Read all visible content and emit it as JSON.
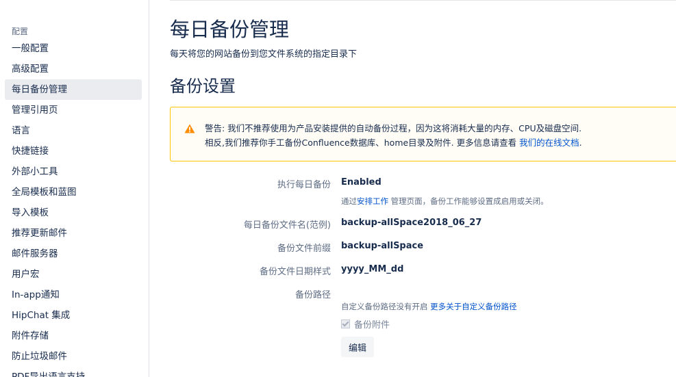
{
  "sidebar": {
    "heading": "配置",
    "items": [
      {
        "label": "一般配置"
      },
      {
        "label": "高级配置"
      },
      {
        "label": "每日备份管理",
        "active": true
      },
      {
        "label": "管理引用页"
      },
      {
        "label": "语言"
      },
      {
        "label": "快捷链接"
      },
      {
        "label": "外部小工具"
      },
      {
        "label": "全局模板和蓝图"
      },
      {
        "label": "导入模板"
      },
      {
        "label": "推荐更新邮件"
      },
      {
        "label": "邮件服务器"
      },
      {
        "label": "用户宏"
      },
      {
        "label": "In-app通知"
      },
      {
        "label": "HipChat 集成"
      },
      {
        "label": "附件存储"
      },
      {
        "label": "防止垃圾邮件"
      },
      {
        "label": "PDF导出语言支持"
      }
    ]
  },
  "main": {
    "title": "每日备份管理",
    "description": "每天将您的网站备份到您文件系统的指定目录下",
    "section_title": "备份设置",
    "warning": {
      "icon": "warning-icon",
      "line1": "警告: 我们不推荐使用为产品安装提供的自动备份过程，因为这将消耗大量的内存、CPU及磁盘空间.",
      "line2_prefix": "相反,我们推荐你手工备份Confluence数据库、home目录及附件. 更多信息请查看 ",
      "line2_link": "我们的在线文档",
      "line2_suffix": "."
    },
    "form": {
      "daily_backup_label": "执行每日备份",
      "daily_backup_value": "Enabled",
      "daily_backup_hint_prefix": "通过",
      "daily_backup_hint_link": "安排工作",
      "daily_backup_hint_suffix": " 管理页面，备份工作能够设置成启用或关闭。",
      "filename_example_label": "每日备份文件名(范例)",
      "filename_example_value": "backup-allSpace2018_06_27",
      "prefix_label": "备份文件前缀",
      "prefix_value": "backup-allSpace",
      "date_pattern_label": "备份文件日期样式",
      "date_pattern_value": "yyyy_MM_dd",
      "path_label": "备份路径",
      "path_hint_prefix": "自定义备份路径没有开启 ",
      "path_hint_link": "更多关于自定义备份路径",
      "attachments_label": "备份附件",
      "attachments_checked": true,
      "edit_label": "编辑"
    }
  },
  "colors": {
    "accent_link": "#0052cc",
    "warning_border": "#ffc400",
    "warning_icon": "#ff8b00",
    "active_item_bg": "#ebecf0"
  }
}
